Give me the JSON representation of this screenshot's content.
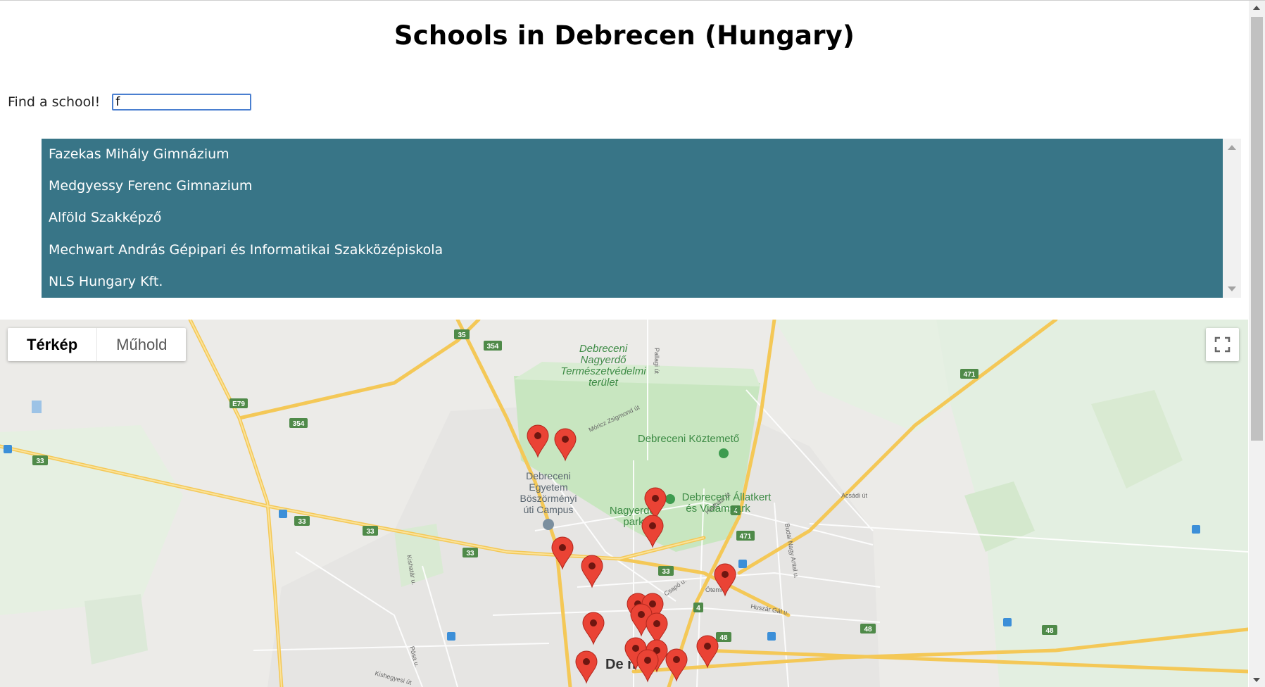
{
  "page": {
    "title": "Schools in Debrecen (Hungary)"
  },
  "search": {
    "label": "Find a school!",
    "value": "f"
  },
  "results": [
    {
      "label": "Fazekas Mihály Gimnázium"
    },
    {
      "label": "Medgyessy Ferenc Gimnazium"
    },
    {
      "label": "Alföld Szakképző"
    },
    {
      "label": "Mechwart András Gépipari és Informatikai Szakközépiskola"
    },
    {
      "label": "NLS Hungary Kft."
    }
  ],
  "map": {
    "type_control": {
      "map_label": "Térkép",
      "satellite_label": "Műhold",
      "selected": "Térkép"
    },
    "fullscreen_icon": "fullscreen-icon",
    "marker_color": "#ea4335",
    "labels": {
      "forest": "Debreceni Nagyerdő Természetvédelmi terület",
      "forest_l1": "Debreceni",
      "forest_l2": "Nagyerdő",
      "forest_l3": "Természetvédelmi",
      "forest_l4": "terület",
      "cemetery": "Debreceni Köztemető",
      "zoo_l1": "Debreceni Állatkert",
      "zoo_l2": "és Vidámpark",
      "park_l1": "Nagyerdei",
      "park_l2": "park",
      "campus_l1": "Debreceni",
      "campus_l2": "Egyetem",
      "campus_l3": "Böszörményi",
      "campus_l4": "úti Campus",
      "city": "Debrecen",
      "city_visible": "De      n",
      "streets": {
        "pallagi": "Pallagi út",
        "moricz": "Móricz Zsigmond út",
        "acsadi": "Acsádi út",
        "hadhazi": "Hadházi út",
        "budai": "Budai Nagy Antal u.",
        "huszar": "Huszár Gál u.",
        "csapo": "Csapó u.",
        "kishatar": "Kishatár u.",
        "kishegyesi": "Kishegyesi út",
        "posa": "Pósa u.",
        "oteni": "Ötemi"
      },
      "shields": {
        "r35": "35",
        "r354": "354",
        "r354b": "354",
        "e79": "E79",
        "r33a": "33",
        "r33b": "33",
        "r33c": "33",
        "r33d": "33",
        "r33e": "33",
        "r33f": "33",
        "r471": "471",
        "r471b": "471",
        "r4": "4",
        "r4b": "4",
        "r48": "48",
        "r48b": "48",
        "r48c": "48"
      }
    },
    "markers_count": 18
  }
}
